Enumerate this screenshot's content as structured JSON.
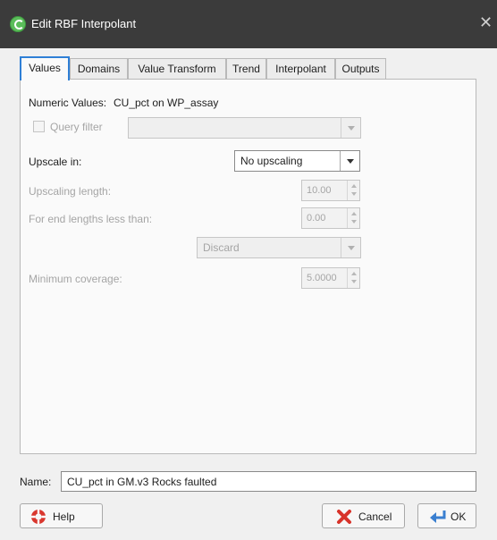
{
  "window": {
    "title": "Edit RBF Interpolant"
  },
  "tabs": [
    {
      "label": "Values",
      "active": true
    },
    {
      "label": "Domains"
    },
    {
      "label": "Value Transform"
    },
    {
      "label": "Trend"
    },
    {
      "label": "Interpolant"
    },
    {
      "label": "Outputs"
    }
  ],
  "values_tab": {
    "numeric_values_label": "Numeric Values:",
    "numeric_values_value": "CU_pct on WP_assay",
    "query_filter_label": "Query filter",
    "query_filter_checked": false,
    "query_filter_value": "",
    "upscale_label": "Upscale in:",
    "upscale_value": "No upscaling",
    "upscaling_length_label": "Upscaling length:",
    "upscaling_length_value": "10.00",
    "end_lengths_label": "For end lengths less than:",
    "end_lengths_value": "0.00",
    "discard_value": "Discard",
    "min_coverage_label": "Minimum coverage:",
    "min_coverage_value": "5.0000"
  },
  "name_field": {
    "label": "Name:",
    "value": "CU_pct in GM.v3 Rocks faulted"
  },
  "buttons": {
    "help": "Help",
    "cancel": "Cancel",
    "ok": "OK"
  },
  "colors": {
    "titlebar": "#3b3b3b",
    "active_tab_border": "#2f7fd6"
  }
}
